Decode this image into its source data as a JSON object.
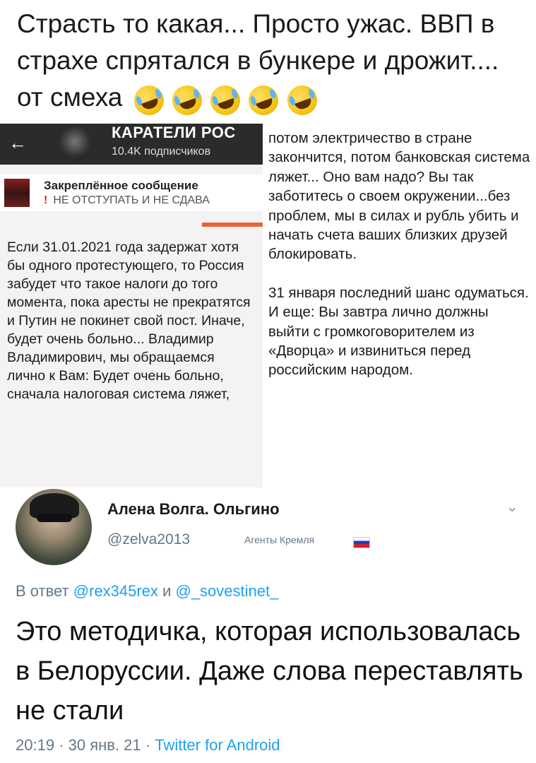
{
  "caption": {
    "text": "Страсть то какая... Просто ужас. ВВП в страхе спрятался в бункере и дрожит.... от смеха",
    "emoji_count": 5,
    "emoji_icon": "rolling-on-floor-laughing-icon"
  },
  "telegram": {
    "back_icon": "←",
    "channel_title": "КАРАТЕЛИ РОС",
    "subscribers": "10.4K подписчиков",
    "pinned_title": "Закреплённое сообщение",
    "pinned_bang": "!",
    "pinned_text": "НЕ ОТСТУПАТЬ И НЕ СДАВА",
    "post_text": "Если 31.01.2021 года задержат хотя бы одного протестующего, то Россия забудет что такое налоги до того момента, пока аресты не прекратятся и Путин не покинет свой пост. Иначе, будет очень больно... Владимир Владимирович, мы обращаемся лично к Вам: Будет очень больно, сначала налоговая система ляжет,"
  },
  "right_column": {
    "paragraph1": "потом электричество в стране закончится, потом банковская система ляжет... Оно вам надо? Вы так заботитесь о своем окружении...без проблем, мы в силах и рубль убить и начать счета ваших близких друзей блокировать.",
    "paragraph2": "31 января последний шанс одуматься. И еще: Вы завтра лично должны выйти с громкоговорителем из «Дворца» и извиниться перед российским народом."
  },
  "tweet": {
    "name": "Алена Волга. Ольгино",
    "handle": "@zelva2013",
    "label": "Агенты Кремля",
    "reply_prefix": "В ответ",
    "mention1": "@rex345rex",
    "reply_and": "и",
    "mention2": "@_sovestinet_",
    "body": "Это методичка, которая использовалась в Белоруссии. Даже слова переставлять не стали",
    "time": "20:19 · 30 янв. 21 ·",
    "client": "Twitter for Android",
    "colors": {
      "link": "#1da1f2",
      "muted": "#657786"
    }
  }
}
